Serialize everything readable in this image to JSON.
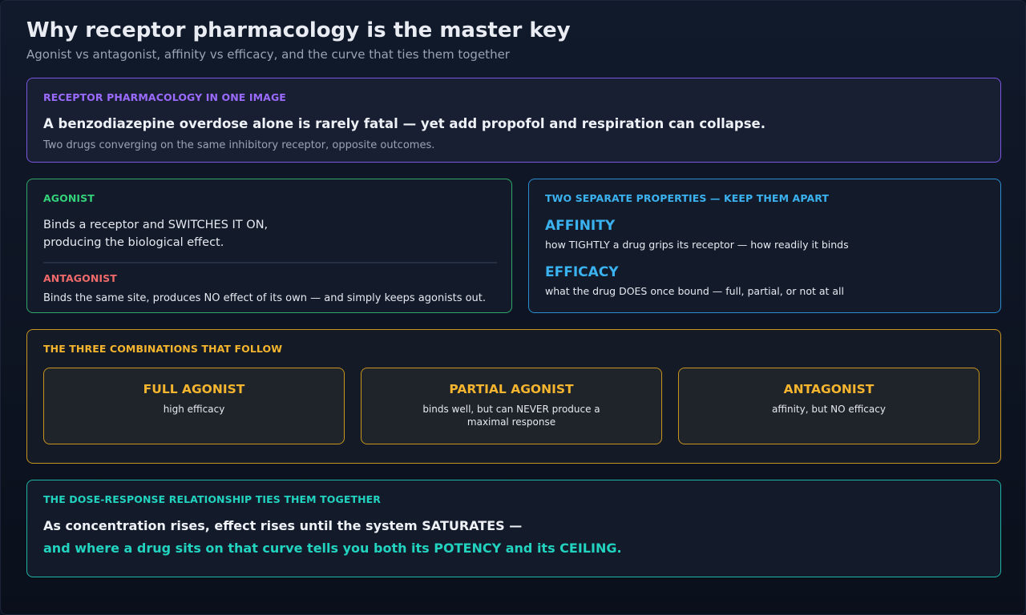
{
  "header": {
    "title": "Why receptor pharmacology is the master key",
    "subtitle": "Agonist vs antagonist, affinity vs efficacy, and the curve that ties them together"
  },
  "intro": {
    "label": "RECEPTOR PHARMACOLOGY IN ONE IMAGE",
    "headline": "A benzodiazepine overdose alone is rarely fatal — yet add propofol and respiration can collapse.",
    "note": "Two drugs converging on the same inhibitory receptor, opposite outcomes."
  },
  "roles": {
    "agonist_label": "AGONIST",
    "agonist_line1": "Binds a receptor and SWITCHES IT ON,",
    "agonist_line2": "producing the biological effect.",
    "antagonist_label": "ANTAGONIST",
    "antagonist_desc": "Binds the same site, produces NO effect of its own — and simply keeps agonists out."
  },
  "properties": {
    "label": "TWO SEPARATE PROPERTIES — KEEP THEM APART",
    "affinity_term": "AFFINITY",
    "affinity_def": "how TIGHTLY a drug grips its receptor — how readily it binds",
    "efficacy_term": "EFFICACY",
    "efficacy_def": "what the drug DOES once bound — full, partial, or not at all"
  },
  "combinations": {
    "label": "THE THREE COMBINATIONS THAT FOLLOW",
    "items": [
      {
        "title": "FULL AGONIST",
        "desc": "high efficacy"
      },
      {
        "title": "PARTIAL AGONIST",
        "desc": "binds well, but can NEVER produce a maximal response"
      },
      {
        "title": "ANTAGONIST",
        "desc": "affinity, but NO efficacy"
      }
    ]
  },
  "dose_response": {
    "label": "THE DOSE-RESPONSE RELATIONSHIP TIES THEM TOGETHER",
    "line1": "As concentration rises, effect rises until the system SATURATES —",
    "line2": "and where a drug sits on that curve tells you both its POTENCY and its CEILING."
  },
  "colors": {
    "purple": "#9b6bff",
    "green": "#34d17a",
    "red": "#f06a6a",
    "blue": "#3bb2f0",
    "amber": "#f5b52e",
    "teal": "#22d3bf"
  }
}
